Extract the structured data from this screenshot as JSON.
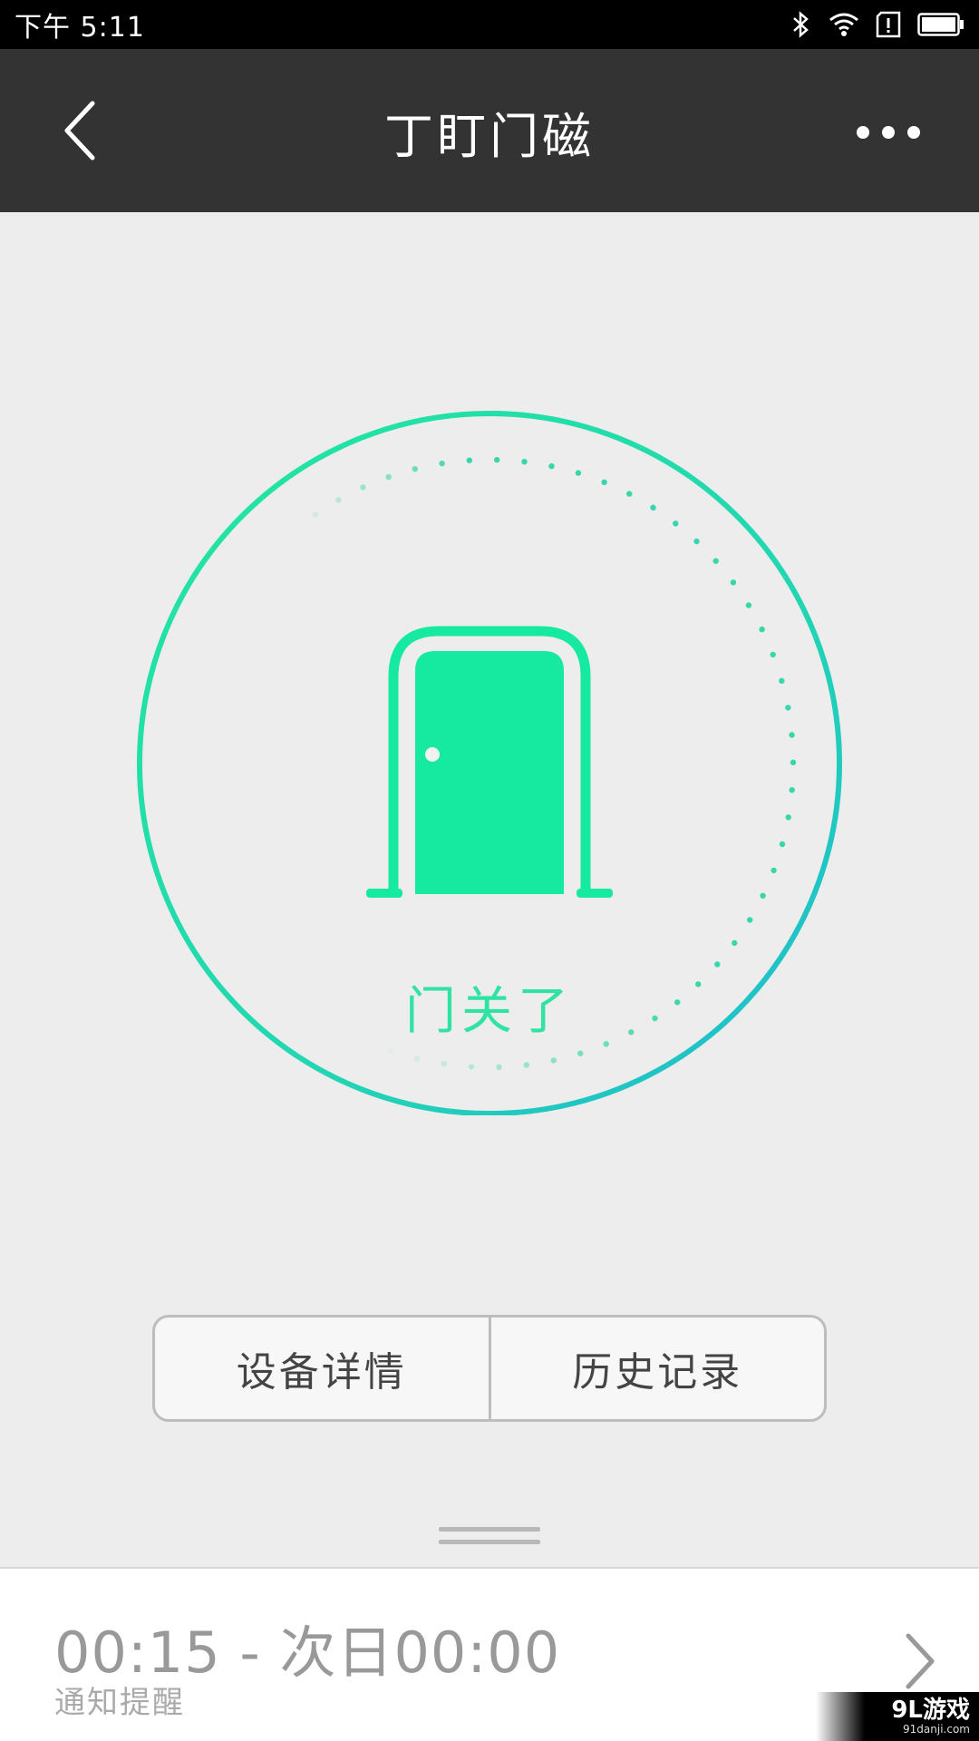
{
  "status_bar": {
    "time": "下午 5:11",
    "icons": [
      "bluetooth-icon",
      "wifi-icon",
      "alert-icon",
      "battery-icon"
    ]
  },
  "nav": {
    "title": "丁盯门磁",
    "back_icon": "chevron-left-icon",
    "more_icon": "more-dots-icon"
  },
  "device_status": {
    "state_text": "门关了",
    "icon": "door-icon",
    "accent_color": "#16e9a0",
    "ring_gradient": [
      "#22e6a0",
      "#1fb8d1"
    ]
  },
  "buttons": {
    "device_details": "设备详情",
    "history": "历史记录"
  },
  "notification": {
    "time_range": "00:15 - 次日00:00",
    "label": "通知提醒"
  },
  "watermark": {
    "main": "9L游戏",
    "sub": "91danji.com"
  }
}
